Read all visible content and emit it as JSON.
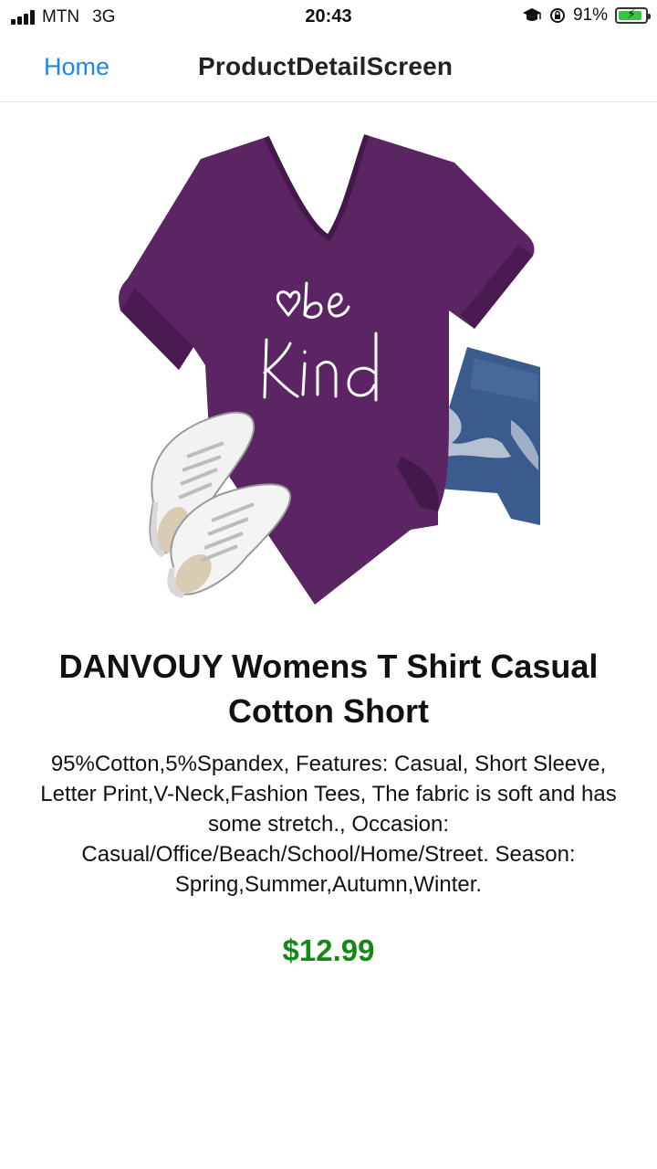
{
  "status_bar": {
    "carrier": "MTN",
    "network": "3G",
    "time": "20:43",
    "battery_percent": "91%",
    "battery_level": 0.91,
    "icons": [
      "signal-icon",
      "graduation-cap-icon",
      "rotation-lock-icon",
      "battery-charging-icon"
    ]
  },
  "nav": {
    "back_label": "Home",
    "title": "ProductDetailScreen"
  },
  "product": {
    "image_name": "purple-be-kind-tshirt-image",
    "shirt_print": "be kind",
    "title": "DANVOUY Womens T Shirt Casual Cotton Short",
    "description": "95%Cotton,5%Spandex, Features: Casual, Short Sleeve, Letter Print,V-Neck,Fashion Tees, The fabric is soft and has some stretch., Occasion: Casual/Office/Beach/School/Home/Street. Season: Spring,Summer,Autumn,Winter.",
    "price": "$12.99",
    "price_color": "#138a13"
  },
  "colors": {
    "link": "#1e88e5",
    "shirt": "#5b2462",
    "jeans": "#3b5b8c"
  }
}
